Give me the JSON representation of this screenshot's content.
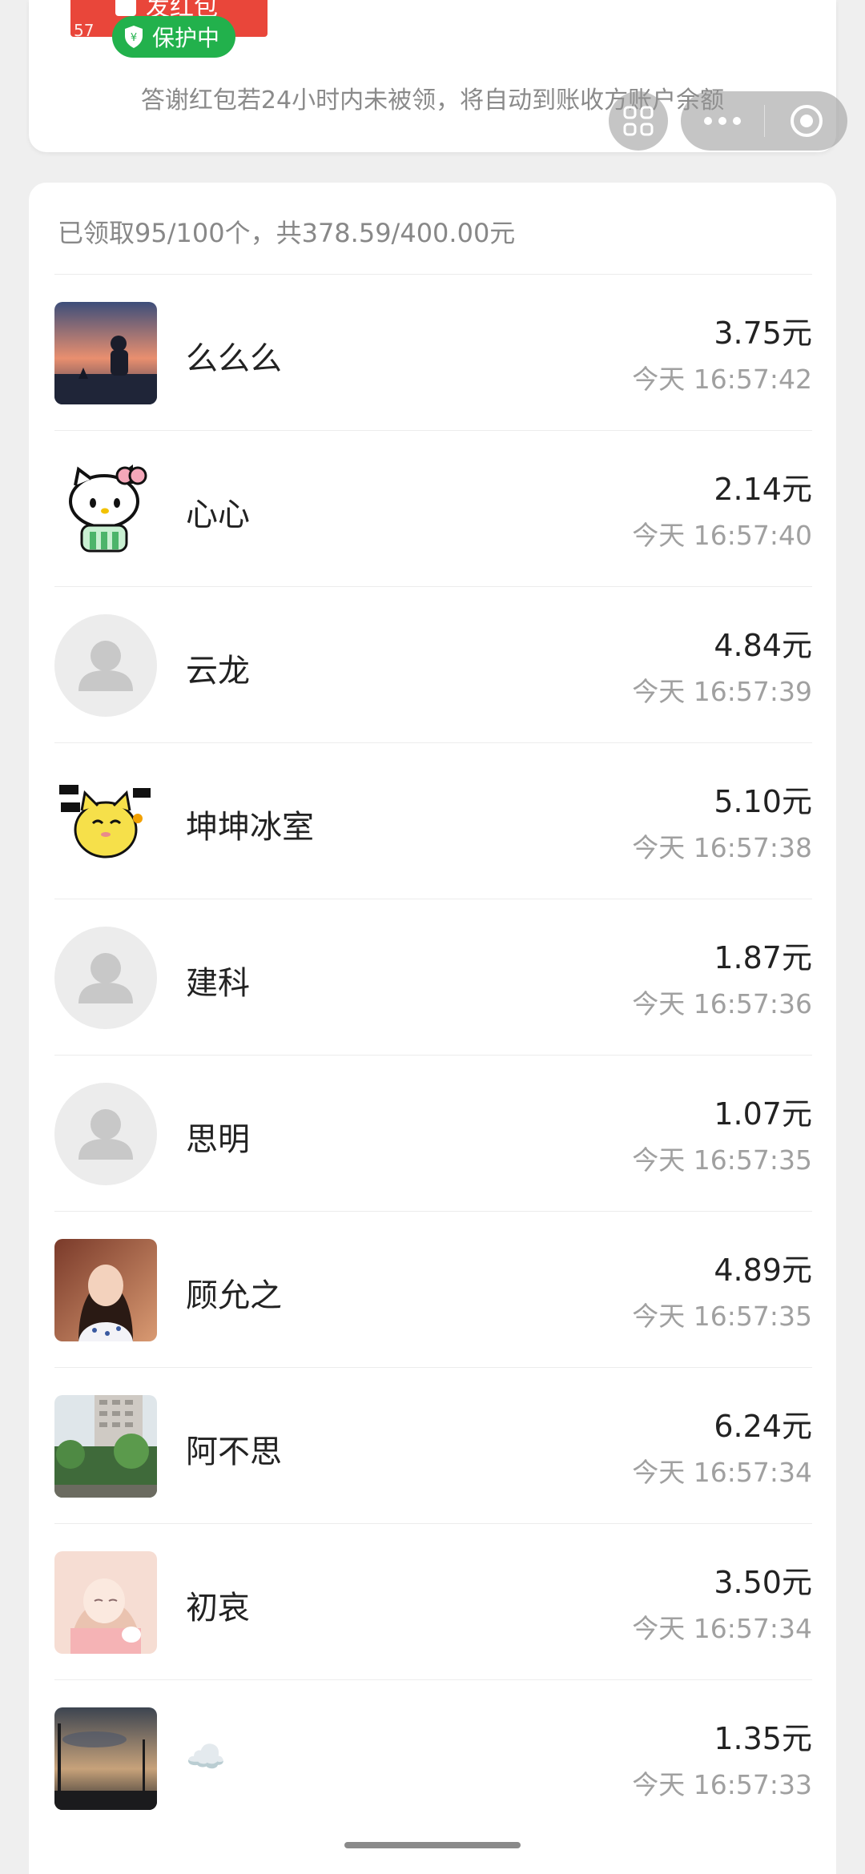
{
  "header": {
    "banner_text": "发红包",
    "banner_number": "57",
    "protect_badge": "保护中",
    "notice": "答谢红包若24小时内未被领，将自动到账收方账户余额"
  },
  "summary": "已领取95/100个，共378.59/400.00元",
  "rows": [
    {
      "name": "么么么",
      "amount": "3.75元",
      "time": "今天 16:57:42",
      "avatar": "photo-sunset-person"
    },
    {
      "name": "心心",
      "amount": "2.14元",
      "time": "今天 16:57:40",
      "avatar": "hello-kitty"
    },
    {
      "name": "云龙",
      "amount": "4.84元",
      "time": "今天 16:57:39",
      "avatar": "default-person"
    },
    {
      "name": "坤坤冰室",
      "amount": "5.10元",
      "time": "今天 16:57:38",
      "avatar": "yellow-cat-sticker"
    },
    {
      "name": "建科",
      "amount": "1.87元",
      "time": "今天 16:57:36",
      "avatar": "default-person"
    },
    {
      "name": "思明",
      "amount": "1.07元",
      "time": "今天 16:57:35",
      "avatar": "default-person"
    },
    {
      "name": "顾允之",
      "amount": "4.89元",
      "time": "今天 16:57:35",
      "avatar": "photo-woman"
    },
    {
      "name": "阿不思",
      "amount": "6.24元",
      "time": "今天 16:57:34",
      "avatar": "photo-buildings-trees"
    },
    {
      "name": "初哀",
      "amount": "3.50元",
      "time": "今天 16:57:34",
      "avatar": "anime-girl-pink"
    },
    {
      "name": "☁️",
      "amount": "1.35元",
      "time": "今天 16:57:33",
      "avatar": "photo-dusk-sky"
    }
  ],
  "colors": {
    "background": "#efefef",
    "card": "#ffffff",
    "red_envelope": "#e9463a",
    "protect_green": "#22b14c",
    "muted_text": "#888888"
  }
}
